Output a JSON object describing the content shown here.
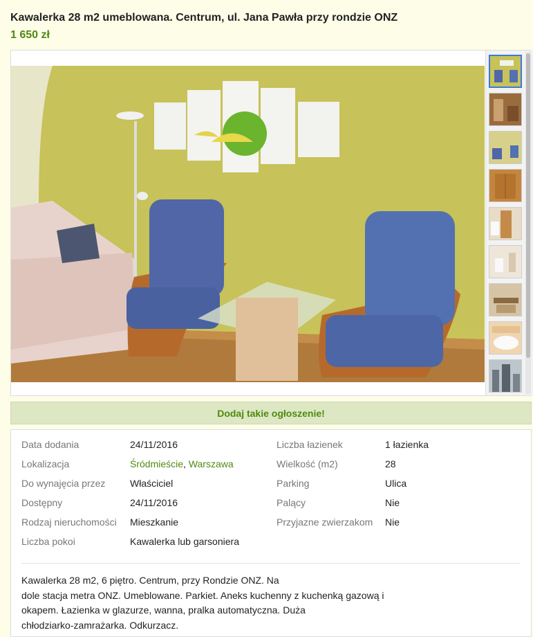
{
  "listing": {
    "title": "Kawalerka 28 m2 umeblowana. Centrum, ul. Jana Pawła przy rondzie ONZ",
    "price": "1 650 zł"
  },
  "gallery": {
    "thumbnail_count": 9,
    "active_index": 0
  },
  "cta": {
    "label": "Dodaj takie ogłoszenie!"
  },
  "details": {
    "left": [
      {
        "label": "Data dodania",
        "value": "24/11/2016"
      },
      {
        "label": "Lokalizacja",
        "value_district": "Śródmieście",
        "value_separator": ", ",
        "value_city": "Warszawa"
      },
      {
        "label": "Do wynajęcia przez",
        "value": "Właściciel"
      },
      {
        "label": "Dostępny",
        "value": "24/11/2016"
      },
      {
        "label": "Rodzaj nieruchomości",
        "value": "Mieszkanie"
      },
      {
        "label": "Liczba pokoi",
        "value": "Kawalerka lub garsoniera"
      }
    ],
    "right": [
      {
        "label": "Liczba łazienek",
        "value": "1 łazienka"
      },
      {
        "label": "Wielkość (m2)",
        "value": "28"
      },
      {
        "label": "Parking",
        "value": "Ulica"
      },
      {
        "label": "Palący",
        "value": "Nie"
      },
      {
        "label": "Przyjazne zwierzakom",
        "value": "Nie"
      }
    ]
  },
  "description": "Kawalerka 28 m2, 6 piętro. Centrum, przy Rondzie ONZ. Na\ndole stacja metra ONZ. Umeblowane. Parkiet. Aneks kuchenny z kuchenką gazową i\nokapem. Łazienka w glazurze, wanna, pralka automatyczna. Duża\nchłodziarko-zamrażarka. Odkurzacz."
}
